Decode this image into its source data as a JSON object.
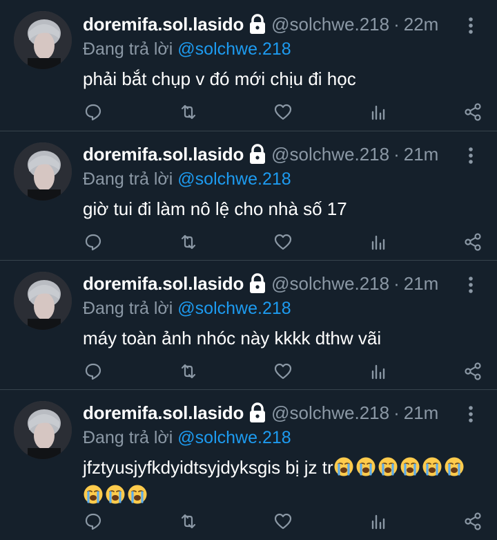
{
  "tweets": [
    {
      "display_name": "doremifa.sol.lasido",
      "handle": "@solchwe.218",
      "separator": "·",
      "time": "22m",
      "reply_prefix": "Đang trả lời",
      "reply_handle": "@solchwe.218",
      "text": "phải bắt chụp v đó mới chịu đi học",
      "emoji_count": 0
    },
    {
      "display_name": "doremifa.sol.lasido",
      "handle": "@solchwe.218",
      "separator": "·",
      "time": "21m",
      "reply_prefix": "Đang trả lời",
      "reply_handle": "@solchwe.218",
      "text": "giờ tui đi làm nô lệ cho nhà số 17",
      "emoji_count": 0
    },
    {
      "display_name": "doremifa.sol.lasido",
      "handle": "@solchwe.218",
      "separator": "·",
      "time": "21m",
      "reply_prefix": "Đang trả lời",
      "reply_handle": "@solchwe.218",
      "text": "máy toàn ảnh nhóc này kkkk dthw vãi",
      "emoji_count": 0
    },
    {
      "display_name": "doremifa.sol.lasido",
      "handle": "@solchwe.218",
      "separator": "·",
      "time": "21m",
      "reply_prefix": "Đang trả lời",
      "reply_handle": "@solchwe.218",
      "text": "jfztyusjyfkdyidtsyjdyksgis bị jz tr",
      "emoji_count": 9,
      "emoji": "loudly-crying-face"
    }
  ],
  "icons": {
    "reply": "reply-icon",
    "retweet": "retweet-icon",
    "like": "like-icon",
    "analytics": "analytics-icon",
    "share": "share-icon",
    "lock": "lock-icon",
    "more": "more-vertical-icon"
  },
  "colors": {
    "background": "#15202b",
    "divider": "#38444d",
    "secondary_text": "#8b98a5",
    "link": "#1d9bf0",
    "primary_text": "#ffffff"
  }
}
